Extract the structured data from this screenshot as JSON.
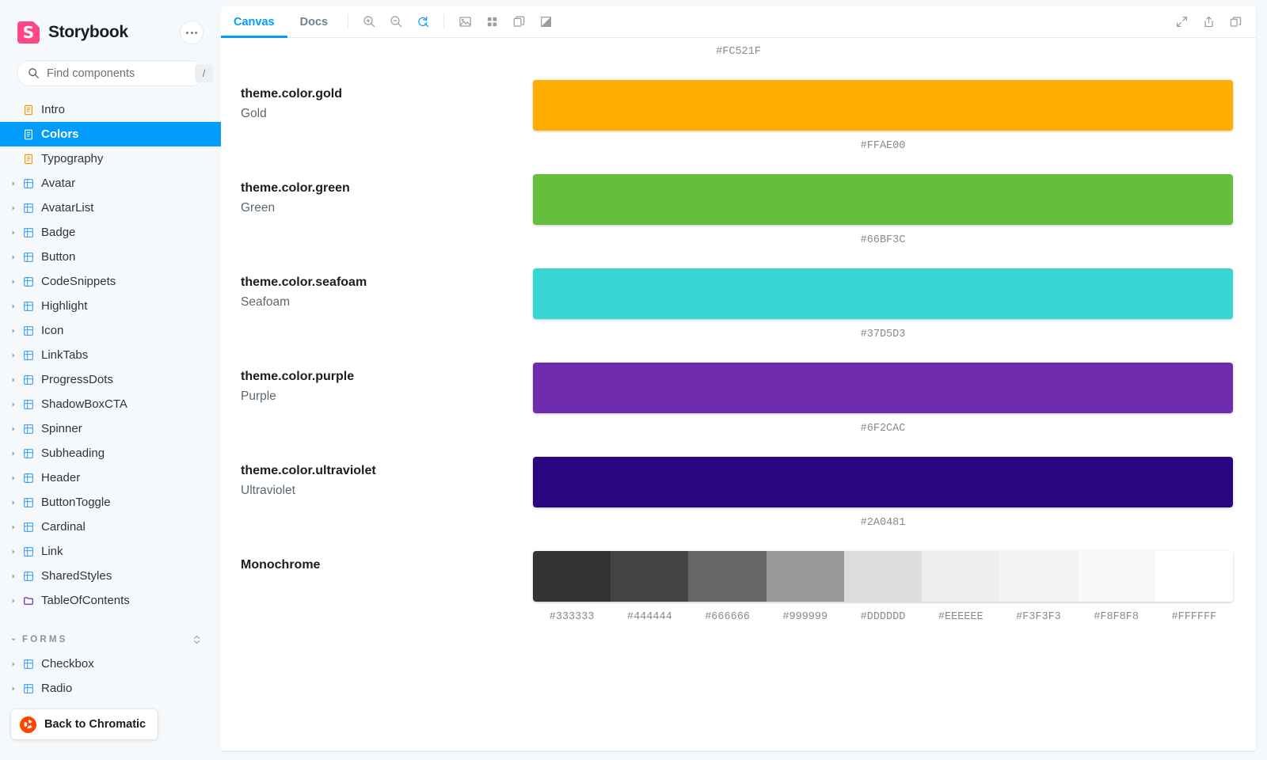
{
  "sidebar": {
    "brand": {
      "name": "Storybook",
      "logo_icon": "storybook-logo",
      "color": "#FF4785"
    },
    "menu_button": {
      "icon": "ellipsis-icon"
    },
    "search": {
      "placeholder": "Find components",
      "value": "",
      "shortcut": "/",
      "icon": "search-icon"
    },
    "tree": [
      {
        "label": "Intro",
        "icon": "document-icon",
        "icon_color": "#FF9800",
        "type": "doc",
        "selected": false,
        "caret": false
      },
      {
        "label": "Colors",
        "icon": "document-icon",
        "icon_color": "#FFFFFF",
        "type": "doc",
        "selected": true,
        "caret": false
      },
      {
        "label": "Typography",
        "icon": "document-icon",
        "icon_color": "#FF9800",
        "type": "doc",
        "selected": false,
        "caret": false
      },
      {
        "label": "Avatar",
        "icon": "component-icon",
        "icon_color": "#4BA7F5",
        "type": "component",
        "selected": false,
        "caret": true
      },
      {
        "label": "AvatarList",
        "icon": "component-icon",
        "icon_color": "#4BA7F5",
        "type": "component",
        "selected": false,
        "caret": true
      },
      {
        "label": "Badge",
        "icon": "component-icon",
        "icon_color": "#4BA7F5",
        "type": "component",
        "selected": false,
        "caret": true
      },
      {
        "label": "Button",
        "icon": "component-icon",
        "icon_color": "#4BA7F5",
        "type": "component",
        "selected": false,
        "caret": true
      },
      {
        "label": "CodeSnippets",
        "icon": "component-icon",
        "icon_color": "#4BA7F5",
        "type": "component",
        "selected": false,
        "caret": true
      },
      {
        "label": "Highlight",
        "icon": "component-icon",
        "icon_color": "#4BA7F5",
        "type": "component",
        "selected": false,
        "caret": true
      },
      {
        "label": "Icon",
        "icon": "component-icon",
        "icon_color": "#4BA7F5",
        "type": "component",
        "selected": false,
        "caret": true
      },
      {
        "label": "LinkTabs",
        "icon": "component-icon",
        "icon_color": "#4BA7F5",
        "type": "component",
        "selected": false,
        "caret": true
      },
      {
        "label": "ProgressDots",
        "icon": "component-icon",
        "icon_color": "#4BA7F5",
        "type": "component",
        "selected": false,
        "caret": true
      },
      {
        "label": "ShadowBoxCTA",
        "icon": "component-icon",
        "icon_color": "#4BA7F5",
        "type": "component",
        "selected": false,
        "caret": true
      },
      {
        "label": "Spinner",
        "icon": "component-icon",
        "icon_color": "#4BA7F5",
        "type": "component",
        "selected": false,
        "caret": true
      },
      {
        "label": "Subheading",
        "icon": "component-icon",
        "icon_color": "#4BA7F5",
        "type": "component",
        "selected": false,
        "caret": true
      },
      {
        "label": "Header",
        "icon": "component-icon",
        "icon_color": "#4BA7F5",
        "type": "component",
        "selected": false,
        "caret": true
      },
      {
        "label": "ButtonToggle",
        "icon": "component-icon",
        "icon_color": "#4BA7F5",
        "type": "component",
        "selected": false,
        "caret": true
      },
      {
        "label": "Cardinal",
        "icon": "component-icon",
        "icon_color": "#4BA7F5",
        "type": "component",
        "selected": false,
        "caret": true
      },
      {
        "label": "Link",
        "icon": "component-icon",
        "icon_color": "#4BA7F5",
        "type": "component",
        "selected": false,
        "caret": true
      },
      {
        "label": "SharedStyles",
        "icon": "component-icon",
        "icon_color": "#4BA7F5",
        "type": "component",
        "selected": false,
        "caret": true
      },
      {
        "label": "TableOfContents",
        "icon": "folder-icon",
        "icon_color": "#6F2CAC",
        "type": "folder",
        "selected": false,
        "caret": true
      }
    ],
    "section": {
      "title": "FORMS",
      "expanded": true,
      "collapse_icon": "expand-collapse-icon"
    },
    "section_items": [
      {
        "label": "Checkbox",
        "icon": "component-icon",
        "icon_color": "#4BA7F5",
        "type": "component",
        "caret": true
      },
      {
        "label": "Radio",
        "icon": "component-icon",
        "icon_color": "#4BA7F5",
        "type": "component",
        "caret": true
      }
    ],
    "chromatic_button": {
      "label": "Back to Chromatic",
      "icon": "chromatic-logo-icon",
      "color": "#FF4400"
    }
  },
  "toolbar": {
    "tabs": [
      {
        "label": "Canvas",
        "active": true
      },
      {
        "label": "Docs",
        "active": false
      }
    ],
    "zoom_controls": [
      {
        "name": "zoom-in-icon",
        "active": false
      },
      {
        "name": "zoom-out-icon",
        "active": false
      },
      {
        "name": "zoom-reset-icon",
        "active": true
      }
    ],
    "addon_controls": [
      {
        "name": "background-image-icon",
        "active": false
      },
      {
        "name": "grid-icon",
        "active": false
      },
      {
        "name": "viewport-icon",
        "active": false
      },
      {
        "name": "contrast-icon",
        "active": false
      }
    ],
    "right_controls": [
      {
        "name": "fullscreen-icon"
      },
      {
        "name": "share-icon"
      },
      {
        "name": "open-in-new-tab-icon"
      }
    ],
    "active_accent": "#029CFD"
  },
  "canvas": {
    "top_partial_hex": "#FC521F",
    "rows": [
      {
        "title": "theme.color.gold",
        "subtitle": "Gold",
        "hex": "#FFAE00"
      },
      {
        "title": "theme.color.green",
        "subtitle": "Green",
        "hex": "#66BF3C"
      },
      {
        "title": "theme.color.seafoam",
        "subtitle": "Seafoam",
        "hex": "#37D5D3"
      },
      {
        "title": "theme.color.purple",
        "subtitle": "Purple",
        "hex": "#6F2CAC"
      },
      {
        "title": "theme.color.ultraviolet",
        "subtitle": "Ultraviolet",
        "hex": "#2A0481"
      }
    ],
    "monochrome": {
      "title": "Monochrome",
      "subtitle": "",
      "hexes": [
        "#333333",
        "#444444",
        "#666666",
        "#999999",
        "#DDDDDD",
        "#EEEEEE",
        "#F3F3F3",
        "#F8F8F8",
        "#FFFFFF"
      ]
    }
  }
}
